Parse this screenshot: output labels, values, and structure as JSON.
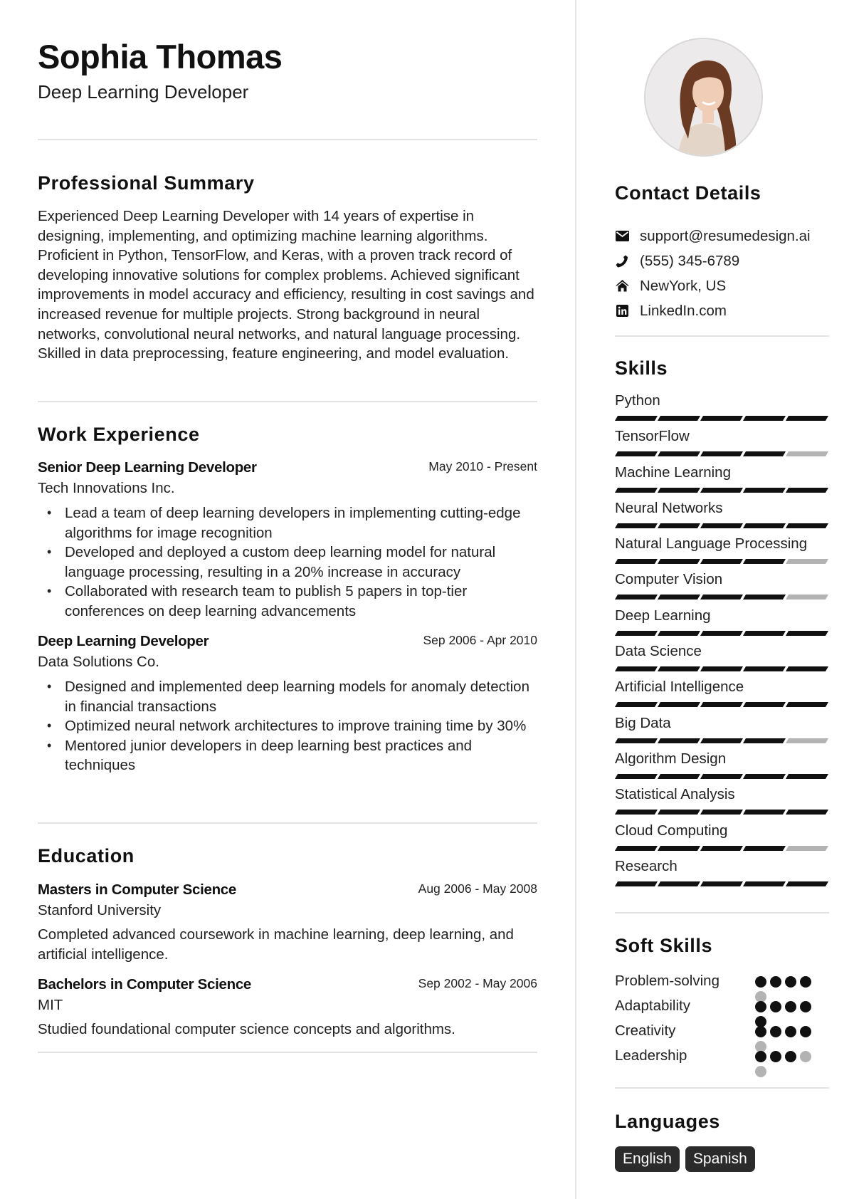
{
  "header": {
    "name": "Sophia Thomas",
    "title": "Deep Learning Developer"
  },
  "summary": {
    "heading": "Professional Summary",
    "text": "Experienced Deep Learning Developer with 14 years of expertise in designing, implementing, and optimizing machine learning algorithms. Proficient in Python, TensorFlow, and Keras, with a proven track record of developing innovative solutions for complex problems. Achieved significant improvements in model accuracy and efficiency, resulting in cost savings and increased revenue for multiple projects. Strong background in neural networks, convolutional neural networks, and natural language processing. Skilled in data preprocessing, feature engineering, and model evaluation."
  },
  "experience": {
    "heading": "Work Experience",
    "jobs": [
      {
        "title": "Senior Deep Learning Developer",
        "dates": "May 2010 - Present",
        "company": "Tech Innovations Inc.",
        "bullets": [
          "Lead a team of deep learning developers in implementing cutting-edge algorithms for image recognition",
          "Developed and deployed a custom deep learning model for natural language processing, resulting in a 20% increase in accuracy",
          "Collaborated with research team to publish 5 papers in top-tier conferences on deep learning advancements"
        ]
      },
      {
        "title": "Deep Learning Developer",
        "dates": "Sep 2006 - Apr 2010",
        "company": "Data Solutions Co.",
        "bullets": [
          "Designed and implemented deep learning models for anomaly detection in financial transactions",
          "Optimized neural network architectures to improve training time by 30%",
          "Mentored junior developers in deep learning best practices and techniques"
        ]
      }
    ]
  },
  "education": {
    "heading": "Education",
    "items": [
      {
        "degree": "Masters in Computer Science",
        "dates": "Aug 2006 - May 2008",
        "school": "Stanford University",
        "description": "Completed advanced coursework in machine learning, deep learning, and artificial intelligence."
      },
      {
        "degree": "Bachelors in Computer Science",
        "dates": "Sep 2002 - May 2006",
        "school": "MIT",
        "description": "Studied foundational computer science concepts and algorithms."
      }
    ]
  },
  "contact": {
    "heading": "Contact Details",
    "items": [
      {
        "icon": "envelope-icon",
        "text": "support@resumedesign.ai"
      },
      {
        "icon": "phone-icon",
        "text": "(555) 345-6789"
      },
      {
        "icon": "home-icon",
        "text": "NewYork, US"
      },
      {
        "icon": "linkedin-icon",
        "text": "LinkedIn.com"
      }
    ]
  },
  "skills": {
    "heading": "Skills",
    "max": 5,
    "items": [
      {
        "name": "Python",
        "level": 5
      },
      {
        "name": "TensorFlow",
        "level": 4
      },
      {
        "name": "Machine Learning",
        "level": 5
      },
      {
        "name": "Neural Networks",
        "level": 5
      },
      {
        "name": "Natural Language Processing",
        "level": 4
      },
      {
        "name": "Computer Vision",
        "level": 4
      },
      {
        "name": "Deep Learning",
        "level": 5
      },
      {
        "name": "Data Science",
        "level": 5
      },
      {
        "name": "Artificial Intelligence",
        "level": 5
      },
      {
        "name": "Big Data",
        "level": 4
      },
      {
        "name": "Algorithm Design",
        "level": 5
      },
      {
        "name": "Statistical Analysis",
        "level": 5
      },
      {
        "name": "Cloud Computing",
        "level": 4
      },
      {
        "name": "Research",
        "level": 5
      }
    ]
  },
  "soft_skills": {
    "heading": "Soft Skills",
    "max": 5,
    "items": [
      {
        "name": "Problem-solving",
        "level": 4
      },
      {
        "name": "Adaptability",
        "level": 5
      },
      {
        "name": "Creativity",
        "level": 4
      },
      {
        "name": "Leadership",
        "level": 3
      }
    ]
  },
  "languages": {
    "heading": "Languages",
    "items": [
      "English",
      "Spanish"
    ]
  },
  "colors": {
    "text": "#1d1d1d",
    "bar_filled": "#111111",
    "bar_empty": "#b3b3b3",
    "badge_bg": "#2b2b2b",
    "divider": "#e2e2e2"
  }
}
